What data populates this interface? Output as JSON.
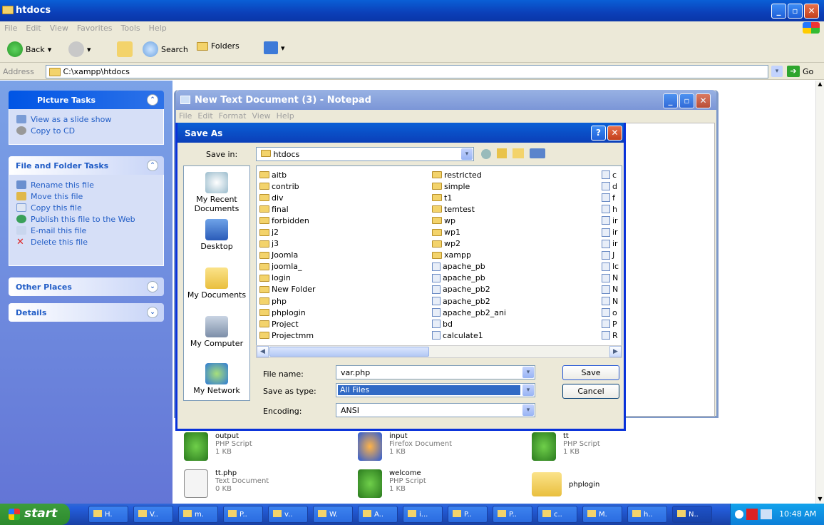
{
  "explorer": {
    "title": "htdocs",
    "menu": [
      "File",
      "Edit",
      "View",
      "Favorites",
      "Tools",
      "Help"
    ],
    "toolbar": {
      "back": "Back",
      "search": "Search",
      "folders": "Folders"
    },
    "address_label": "Address",
    "address": "C:\\xampp\\htdocs",
    "go": "Go"
  },
  "left": {
    "picture_tasks": {
      "title": "Picture Tasks",
      "items": [
        "View as a slide show",
        "Copy to CD"
      ]
    },
    "file_tasks": {
      "title": "File and Folder Tasks",
      "items": [
        "Rename this file",
        "Move this file",
        "Copy this file",
        "Publish this file to the Web",
        "E-mail this file",
        "Delete this file"
      ]
    },
    "other_places": "Other Places",
    "details": "Details"
  },
  "notepad": {
    "title": "New Text Document (3) - Notepad",
    "menu": [
      "File",
      "Edit",
      "Format",
      "View",
      "Help"
    ]
  },
  "saveas": {
    "title": "Save As",
    "save_in_label": "Save in:",
    "save_in": "htdocs",
    "places": [
      "My Recent Documents",
      "Desktop",
      "My Documents",
      "My Computer",
      "My Network"
    ],
    "col1": [
      "aitb",
      "contrib",
      "div",
      "final",
      "forbidden",
      "j2",
      "j3",
      "Joomla",
      "joomla_",
      "login",
      "New Folder",
      "php",
      "phplogin",
      "Project",
      "Projectmm"
    ],
    "col2": [
      "restricted",
      "simple",
      "t1",
      "temtest",
      "wp",
      "wp1",
      "wp2",
      "xampp",
      "apache_pb",
      "apache_pb",
      "apache_pb2",
      "apache_pb2",
      "apache_pb2_ani",
      "bd",
      "calculate1"
    ],
    "col3": [
      "c",
      "d",
      "f",
      "h",
      "ir",
      "ir",
      "ir",
      "J",
      "lc",
      "N",
      "N",
      "N",
      "o",
      "P",
      "R"
    ],
    "filename_label": "File name:",
    "filename": "var.php",
    "type_label": "Save as type:",
    "type": "All Files",
    "encoding_label": "Encoding:",
    "encoding": "ANSI",
    "save": "Save",
    "cancel": "Cancel"
  },
  "files": [
    {
      "name": "output",
      "type": "PHP Script",
      "size": "1 KB"
    },
    {
      "name": "input",
      "type": "Firefox Document",
      "size": "1 KB"
    },
    {
      "name": "tt",
      "type": "PHP Script",
      "size": "1 KB"
    },
    {
      "name": "tt.php",
      "type": "Text Document",
      "size": "0 KB"
    },
    {
      "name": "welcome",
      "type": "PHP Script",
      "size": "1 KB"
    },
    {
      "name": "phplogin",
      "type": "",
      "size": ""
    }
  ],
  "taskbar": {
    "start": "start",
    "buttons": [
      "H.",
      "V..",
      "m.",
      "P..",
      "v..",
      "W.",
      "A..",
      "i...",
      "P..",
      "P..",
      "c..",
      "M.",
      "h..",
      "N.."
    ],
    "time": "10:48 AM"
  },
  "colors": {
    "xp_blue": "#0a5fd6",
    "start_green": "#3c9d3c",
    "dialog_border": "#0831d9"
  }
}
